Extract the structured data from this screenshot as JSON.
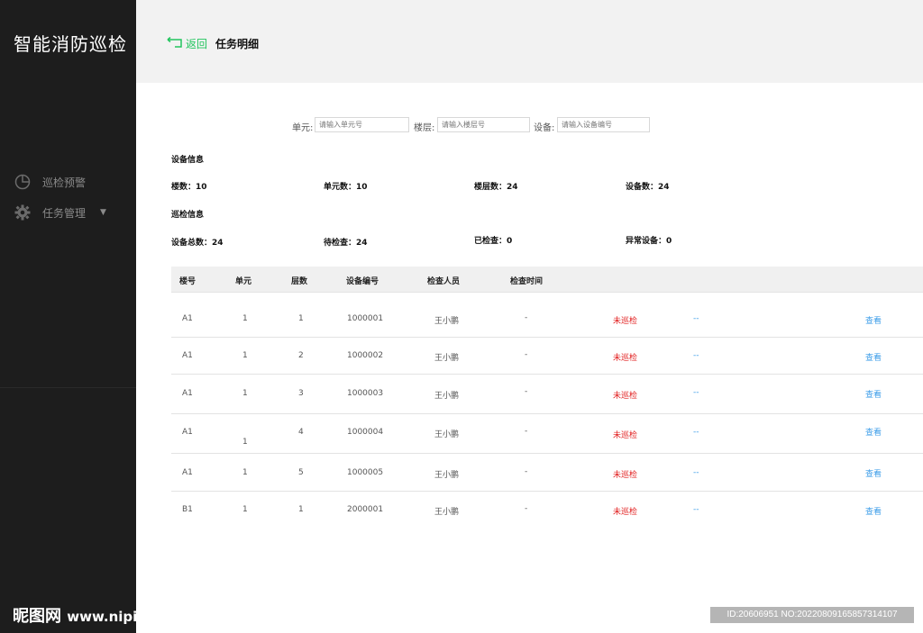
{
  "app": {
    "title": "智能消防巡检"
  },
  "sidebar": {
    "items": [
      {
        "label": "巡检预警",
        "icon": "pie-chart-icon"
      },
      {
        "label": "任务管理",
        "icon": "gear-icon",
        "caret": "▼"
      }
    ]
  },
  "header": {
    "back_label": "返回",
    "page_title": "任务明细"
  },
  "filters": {
    "unit_label": "单元:",
    "unit_placeholder": "请输入单元号",
    "floor_label": "楼层:",
    "floor_placeholder": "请输入楼层号",
    "device_label": "设备:",
    "device_placeholder": "请输入设备编号"
  },
  "device_info": {
    "title": "设备信息",
    "buildings": "楼数：10",
    "units": "单元数：10",
    "floors": "楼层数：24",
    "devices": "设备数：24"
  },
  "patrol_info": {
    "title": "巡检信息",
    "total": "设备总数：24",
    "pending": "待检查：24",
    "checked": "已检查：0",
    "abnormal": "异常设备：0"
  },
  "table": {
    "headers": [
      "楼号",
      "单元",
      "层数",
      "设备编号",
      "检查人员",
      "检查时间"
    ],
    "rows": [
      [
        "A1",
        "1",
        "1",
        "1000001",
        "王小鹏",
        "-",
        "未巡检",
        "--",
        "查看"
      ],
      [
        "A1",
        "1",
        "2",
        "1000002",
        "王小鹏",
        "-",
        "未巡检",
        "--",
        "查看"
      ],
      [
        "A1",
        "1",
        "3",
        "1000003",
        "王小鹏",
        "-",
        "未巡检",
        "--",
        "查看"
      ],
      [
        "A1",
        "1",
        "4",
        "1000004",
        "王小鹏",
        "-",
        "未巡检",
        "--",
        "查看"
      ],
      [
        "A1",
        "1",
        "5",
        "1000005",
        "王小鹏",
        "-",
        "未巡检",
        "--",
        "查看"
      ],
      [
        "B1",
        "1",
        "1",
        "2000001",
        "王小鹏",
        "-",
        "未巡检",
        "--",
        "查看"
      ]
    ]
  },
  "watermark": {
    "left_brand": "昵图网",
    "left_url": "www.nipic.com",
    "right_id": "ID:20606951 NO:20220809165857314107"
  },
  "colors": {
    "sidebar": "#1d1d1d",
    "accent_green": "#22c55e",
    "status_red": "#e11d1d",
    "link_blue": "#3b9ce8"
  }
}
